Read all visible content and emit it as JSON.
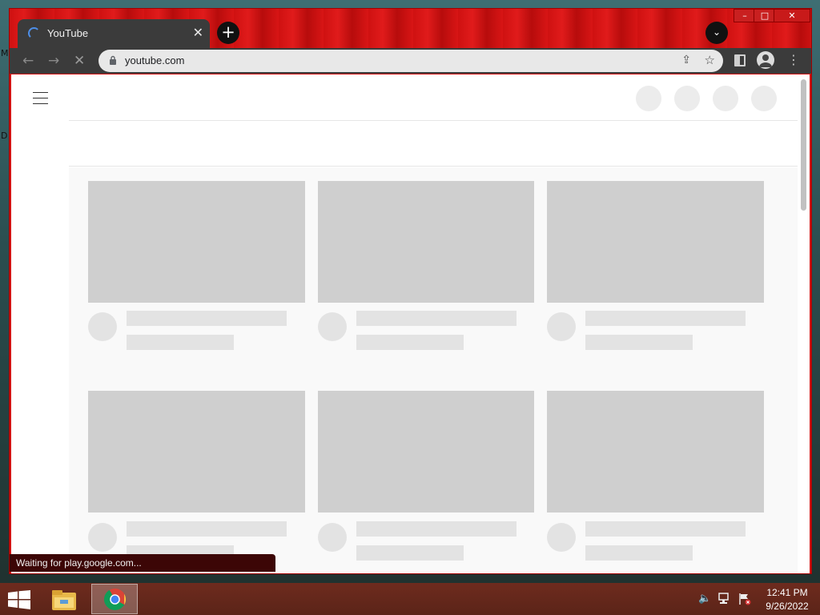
{
  "desktop": {
    "edge_letters": [
      "M",
      "D"
    ]
  },
  "window": {
    "controls": {
      "minimize": "–",
      "maximize": "□",
      "close": "✕"
    }
  },
  "tab": {
    "title": "YouTube",
    "close_glyph": "✕"
  },
  "tabstrip": {
    "new_tab_glyph": "+",
    "tab_search_glyph": "⌄"
  },
  "toolbar": {
    "back_glyph": "←",
    "forward_glyph": "→",
    "stop_glyph": "✕",
    "url": "youtube.com",
    "share_glyph": "⇪",
    "bookmark_glyph": "☆",
    "menu_glyph": "⋮"
  },
  "page": {
    "placeholder_count": 6,
    "header_circle_count": 4
  },
  "status_bar": {
    "text": "Waiting for play.google.com..."
  },
  "taskbar": {
    "clock_time": "12:41 PM",
    "clock_date": "9/26/2022",
    "tray_icons": [
      "speaker-muted-icon",
      "network-icon",
      "action-center-flag-icon"
    ]
  },
  "colors": {
    "window_frame": "#d41414",
    "tab_bg": "#3b3b3b",
    "skeleton": "#cfcfcf",
    "taskbar": "#6e2b1e",
    "status_bg": "#3c0606"
  }
}
